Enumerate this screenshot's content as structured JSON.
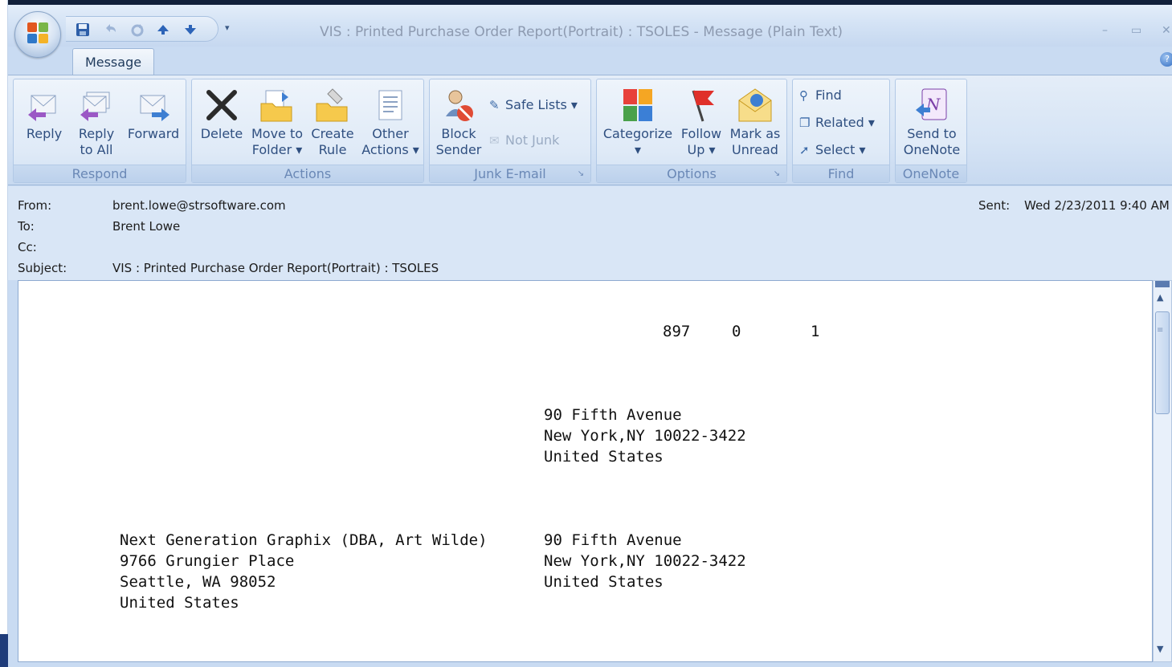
{
  "window": {
    "title": "VIS : Printed Purchase Order Report(Portrait) : TSOLES  -  Message (Plain Text)",
    "quick_access": [
      "save-icon",
      "undo-icon",
      "redo-icon",
      "up-arrow-icon",
      "down-arrow-icon"
    ],
    "controls": {
      "minimize": "–",
      "maximize": "▭",
      "close": "✕"
    }
  },
  "tabs": [
    {
      "label": "Message"
    }
  ],
  "ribbon": {
    "respond": {
      "label": "Respond",
      "buttons": [
        {
          "line1": "Reply",
          "line2": "",
          "icon": "reply-icon"
        },
        {
          "line1": "Reply",
          "line2": "to All",
          "icon": "reply-all-icon"
        },
        {
          "line1": "Forward",
          "line2": "",
          "icon": "forward-icon"
        }
      ]
    },
    "actions": {
      "label": "Actions",
      "buttons": [
        {
          "line1": "Delete",
          "line2": "",
          "icon": "delete-icon"
        },
        {
          "line1": "Move to",
          "line2": "Folder ▾",
          "icon": "move-to-folder-icon"
        },
        {
          "line1": "Create",
          "line2": "Rule",
          "icon": "create-rule-icon"
        },
        {
          "line1": "Other",
          "line2": "Actions ▾",
          "icon": "other-actions-icon"
        }
      ]
    },
    "junk": {
      "label": "Junk E-mail",
      "block_line1": "Block",
      "block_line2": "Sender",
      "safe_lists": "Safe Lists ▾",
      "not_junk": "Not Junk"
    },
    "options": {
      "label": "Options",
      "buttons": [
        {
          "line1": "Categorize",
          "line2": "▾",
          "icon": "categorize-icon"
        },
        {
          "line1": "Follow",
          "line2": "Up ▾",
          "icon": "follow-up-flag-icon"
        },
        {
          "line1": "Mark as",
          "line2": "Unread",
          "icon": "mark-unread-icon"
        }
      ]
    },
    "find": {
      "label": "Find",
      "find": "Find",
      "related": "Related ▾",
      "select": "Select ▾"
    },
    "onenote": {
      "label": "OneNote",
      "line1": "Send to",
      "line2": "OneNote"
    }
  },
  "header": {
    "from_label": "From:",
    "from_value": "brent.lowe@strsoftware.com",
    "to_label": "To:",
    "to_value": "Brent Lowe",
    "cc_label": "Cc:",
    "cc_value": "",
    "subject_label": "Subject:",
    "subject_value": "VIS : Printed Purchase Order Report(Portrait) : TSOLES",
    "sent_label": "Sent:",
    "sent_value": "Wed 2/23/2011 9:40 AM"
  },
  "body": {
    "header_numbers": [
      "897",
      "0",
      "1"
    ],
    "ship_address": [
      "90 Fifth Avenue",
      "New York,NY 10022-3422",
      "United States"
    ],
    "vendor_address": [
      "Next Generation Graphix (DBA, Art Wilde)",
      "9766 Grungier Place",
      "Seattle, WA 98052",
      "United States"
    ],
    "bill_address": [
      "90 Fifth Avenue",
      "New York,NY 10022-3422",
      "United States"
    ]
  },
  "colors": {
    "ribbon_text": "#2f4f80",
    "group_label": "#6a88b6",
    "window_bg": "#c9dbf2",
    "title_text": "#8d9ab0"
  }
}
